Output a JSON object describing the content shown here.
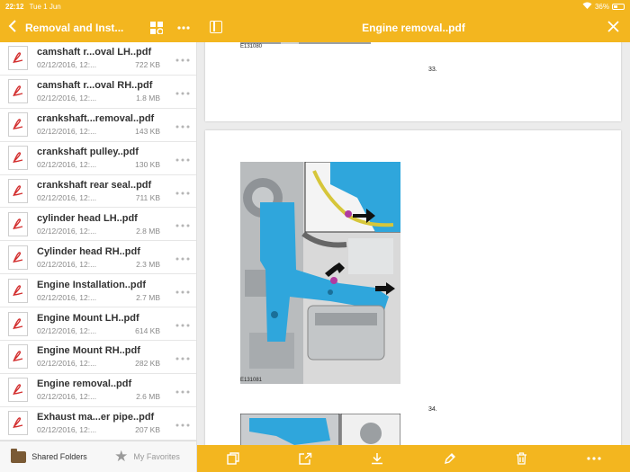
{
  "status_bar": {
    "time": "22:12",
    "date": "Tue 1 Jun",
    "battery": "36%"
  },
  "sidebar": {
    "title": "Removal and Inst...",
    "files": [
      {
        "name": "camshaft r...oval LH..pdf",
        "date": "02/12/2016, 12:...",
        "size": "722 KB"
      },
      {
        "name": "camshaft r...oval RH..pdf",
        "date": "02/12/2016, 12:...",
        "size": "1.8 MB"
      },
      {
        "name": "crankshaft...removal..pdf",
        "date": "02/12/2016, 12:...",
        "size": "143 KB"
      },
      {
        "name": "crankshaft pulley..pdf",
        "date": "02/12/2016, 12:...",
        "size": "130 KB"
      },
      {
        "name": "crankshaft rear seal..pdf",
        "date": "02/12/2016, 12:...",
        "size": "711 KB"
      },
      {
        "name": "cylinder head LH..pdf",
        "date": "02/12/2016, 12:...",
        "size": "2.8 MB"
      },
      {
        "name": "Cylinder head RH..pdf",
        "date": "02/12/2016, 12:...",
        "size": "2.3 MB"
      },
      {
        "name": "Engine Installation..pdf",
        "date": "02/12/2016, 12:...",
        "size": "2.7 MB"
      },
      {
        "name": "Engine Mount LH..pdf",
        "date": "02/12/2016, 12:...",
        "size": "614 KB"
      },
      {
        "name": "Engine Mount RH..pdf",
        "date": "02/12/2016, 12:...",
        "size": "282 KB"
      },
      {
        "name": "Engine removal..pdf",
        "date": "02/12/2016, 12:...",
        "size": "2.6 MB"
      },
      {
        "name": "Exhaust ma...er pipe..pdf",
        "date": "02/12/2016, 12:...",
        "size": "207 KB"
      }
    ],
    "footer": {
      "shared_label": "Shared Folders",
      "favorites_label": "My Favorites"
    }
  },
  "viewer": {
    "title": "Engine removal..pdf",
    "page_numbers": {
      "prev": "33.",
      "current": "34."
    },
    "figure_labels": {
      "top": "E131080",
      "main": "E131081"
    }
  },
  "colors": {
    "accent": "#f3b61f",
    "bracket": "#2fa6dc",
    "bg": "#ececec"
  }
}
